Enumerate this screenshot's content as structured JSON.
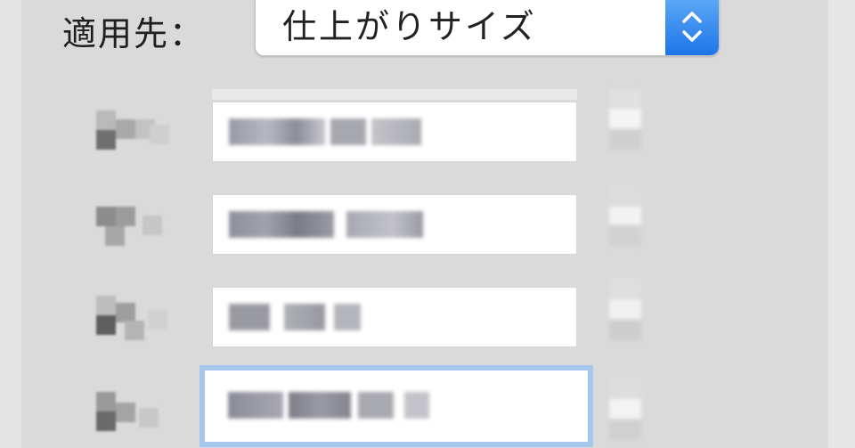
{
  "apply_to": {
    "label": "適用先：",
    "selected_value": "仕上がりサイズ",
    "stepper_icon": "up-down-chevrons-icon"
  },
  "colors": {
    "panel_bg": "#dadada",
    "field_bg": "#ffffff",
    "focus_ring": "#a7c6ec",
    "stepper_blue": "#1d75e8"
  }
}
